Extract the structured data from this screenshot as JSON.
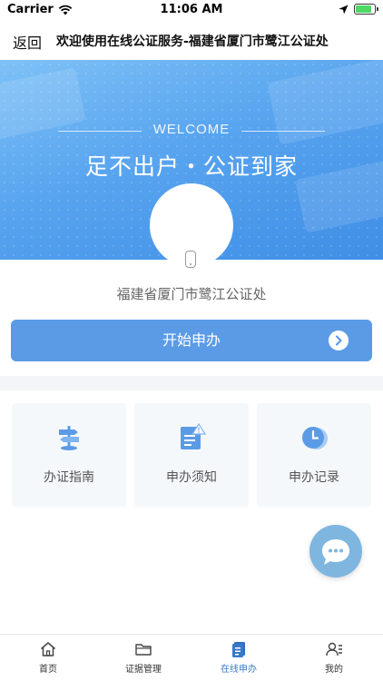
{
  "status_bar": {
    "carrier": "Carrier",
    "time": "11:06 AM",
    "battery_level": 0.85
  },
  "nav": {
    "back_label": "返回",
    "title": "欢迎使用在线公证服务-福建省厦门市鹭江公证处"
  },
  "banner": {
    "welcome": "WELCOME",
    "slogan": "足不出户・公证到家"
  },
  "office_name": "福建省厦门市鹭江公证处",
  "start_button": {
    "label": "开始申办"
  },
  "cards": [
    {
      "label": "办证指南",
      "icon": "signpost-icon"
    },
    {
      "label": "申办须知",
      "icon": "notice-document-icon"
    },
    {
      "label": "申办记录",
      "icon": "clock-icon"
    }
  ],
  "tabs": [
    {
      "label": "首页",
      "icon": "home-icon",
      "active": false
    },
    {
      "label": "证据管理",
      "icon": "folder-icon",
      "active": false
    },
    {
      "label": "在线申办",
      "icon": "document-icon",
      "active": true
    },
    {
      "label": "我的",
      "icon": "profile-icon",
      "active": false
    }
  ],
  "colors": {
    "primary": "#5b9be6",
    "accent": "#3a79c9",
    "card_bg": "#f5f8fb",
    "chat_button": "#7eb6e0"
  }
}
